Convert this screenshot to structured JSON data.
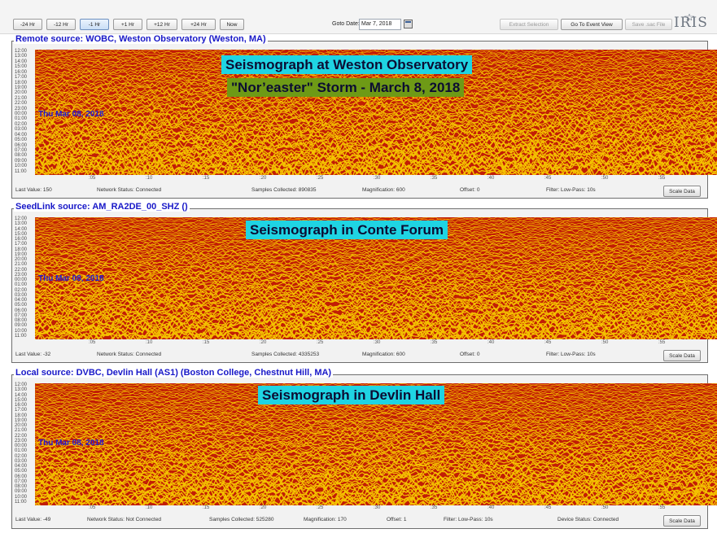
{
  "toolbar": {
    "time_buttons": [
      "-24 Hr",
      "-12 Hr",
      "-1 Hr",
      "+1 Hr",
      "+12 Hr",
      "+24 Hr",
      "Now"
    ],
    "goto_label": "Goto Date:",
    "goto_value": "Mar 7, 2018",
    "extract_label": "Extract Selection",
    "event_view_label": "Go To Event View",
    "save_label": "Save .sac File",
    "logo_text": "IRIS"
  },
  "colors": {
    "trace_fill": "#c21d06",
    "trace_line": "#f5c400",
    "title_blue": "#1818c8"
  },
  "panels": [
    {
      "title": "Remote source: WOBC, Weston Observatory (Weston, MA)",
      "date_label": "Thu Mar 08, 2018",
      "overlays": [
        {
          "text": "Seismograph at Weston Observatory",
          "style": "cyan"
        },
        {
          "text": "\"Nor’easter\" Storm - March 8, 2018",
          "style": "green"
        }
      ],
      "status": {
        "last_value": "Last Value:  150",
        "network": "Network Status:  Connected",
        "samples": "Samples Collected:  890835",
        "magnification": "Magnification:  600",
        "offset": "Offset:  0",
        "filter": "Filter:  Low-Pass: 10s",
        "device": ""
      },
      "scale_label": "Scale Data"
    },
    {
      "title": "SeedLink source: AM_RA2DE_00_SHZ ()",
      "date_label": "Thu Mar 08, 2018",
      "overlays": [
        {
          "text": "Seismograph in Conte Forum",
          "style": "cyan"
        }
      ],
      "status": {
        "last_value": "Last Value:  -32",
        "network": "Network Status:  Connected",
        "samples": "Samples Collected:  4335253",
        "magnification": "Magnification:  600",
        "offset": "Offset:  0",
        "filter": "Filter:  Low-Pass: 10s",
        "device": ""
      },
      "scale_label": "Scale Data"
    },
    {
      "title": "Local source: DVBC, Devlin Hall (AS1) (Boston College, Chestnut Hill, MA)",
      "date_label": "Thu Mar 08, 2018",
      "overlays": [
        {
          "text": "Seismograph in Devlin Hall",
          "style": "cyan"
        }
      ],
      "status": {
        "last_value": "Last Value:  -49",
        "network": "Network Status:  Not Connected",
        "samples": "Samples Collected:  525280",
        "magnification": "Magnification:  170",
        "offset": "Offset:  1",
        "filter": "Filter:  Low-Pass: 10s",
        "device": "Device Status:  Connected"
      },
      "scale_label": "Scale Data"
    }
  ],
  "hour_labels": [
    "12:00",
    "13:00",
    "14:00",
    "15:00",
    "16:00",
    "17:00",
    "18:00",
    "19:00",
    "20:00",
    "21:00",
    "22:00",
    "23:00",
    "00:00",
    "01:00",
    "02:00",
    "03:00",
    "04:00",
    "05:00",
    "06:00",
    "07:00",
    "08:00",
    "09:00",
    "10:00",
    "11:00"
  ],
  "minute_ticks": [
    ":05",
    ":10",
    ":15",
    ":20",
    ":25",
    ":30",
    ":35",
    ":40",
    ":45",
    ":50",
    ":55"
  ]
}
